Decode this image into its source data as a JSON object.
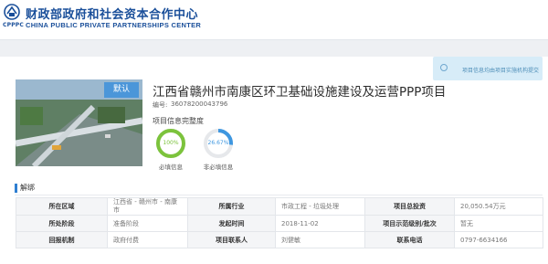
{
  "header": {
    "logo_sub": "CPPPC",
    "site_name_cn": "财政部政府和社会资本合作中心",
    "site_name_en": "CHINA PUBLIC PRIVATE PARTNERSHIPS CENTER"
  },
  "banner": {
    "text": "项目信息均由项目实施机构提交"
  },
  "project": {
    "badge": "默认",
    "title": "江西省赣州市南康区环卫基础设施建设及运营PPP项目",
    "code_label": "编号:",
    "code": "36078200043796",
    "completeness_label": "项目信息完整度",
    "rings": [
      {
        "name": "required",
        "value_text": "100%",
        "value": 1.0,
        "label": "必填信息",
        "color": "#7cc33c"
      },
      {
        "name": "optional",
        "value_text": "26.67%",
        "value": 0.2667,
        "label": "非必填信息",
        "color": "#3e97e0"
      }
    ]
  },
  "section": {
    "title": "解绑"
  },
  "info_table": {
    "rows": [
      {
        "l1": "所在区域",
        "v1": "江西省 - 赣州市 - 南康市",
        "l2": "所属行业",
        "v2": "市政工程 - 垃圾处理",
        "l3": "项目总投资",
        "v3": "20,050.54万元"
      },
      {
        "l1": "所处阶段",
        "v1": "准备阶段",
        "l2": "发起时间",
        "v2": "2018-11-02",
        "l3": "项目示范级别/批次",
        "v3": "暂无"
      },
      {
        "l1": "回报机制",
        "v1": "政府付费",
        "l2": "项目联系人",
        "v2": "刘健敏",
        "l3": "联系电话",
        "v3": "0797-6634166"
      }
    ]
  },
  "colors": {
    "brand": "#1a4f9a",
    "accent": "#4b96d9",
    "progress_required": "#7cc33c",
    "progress_optional": "#3e97e0"
  }
}
